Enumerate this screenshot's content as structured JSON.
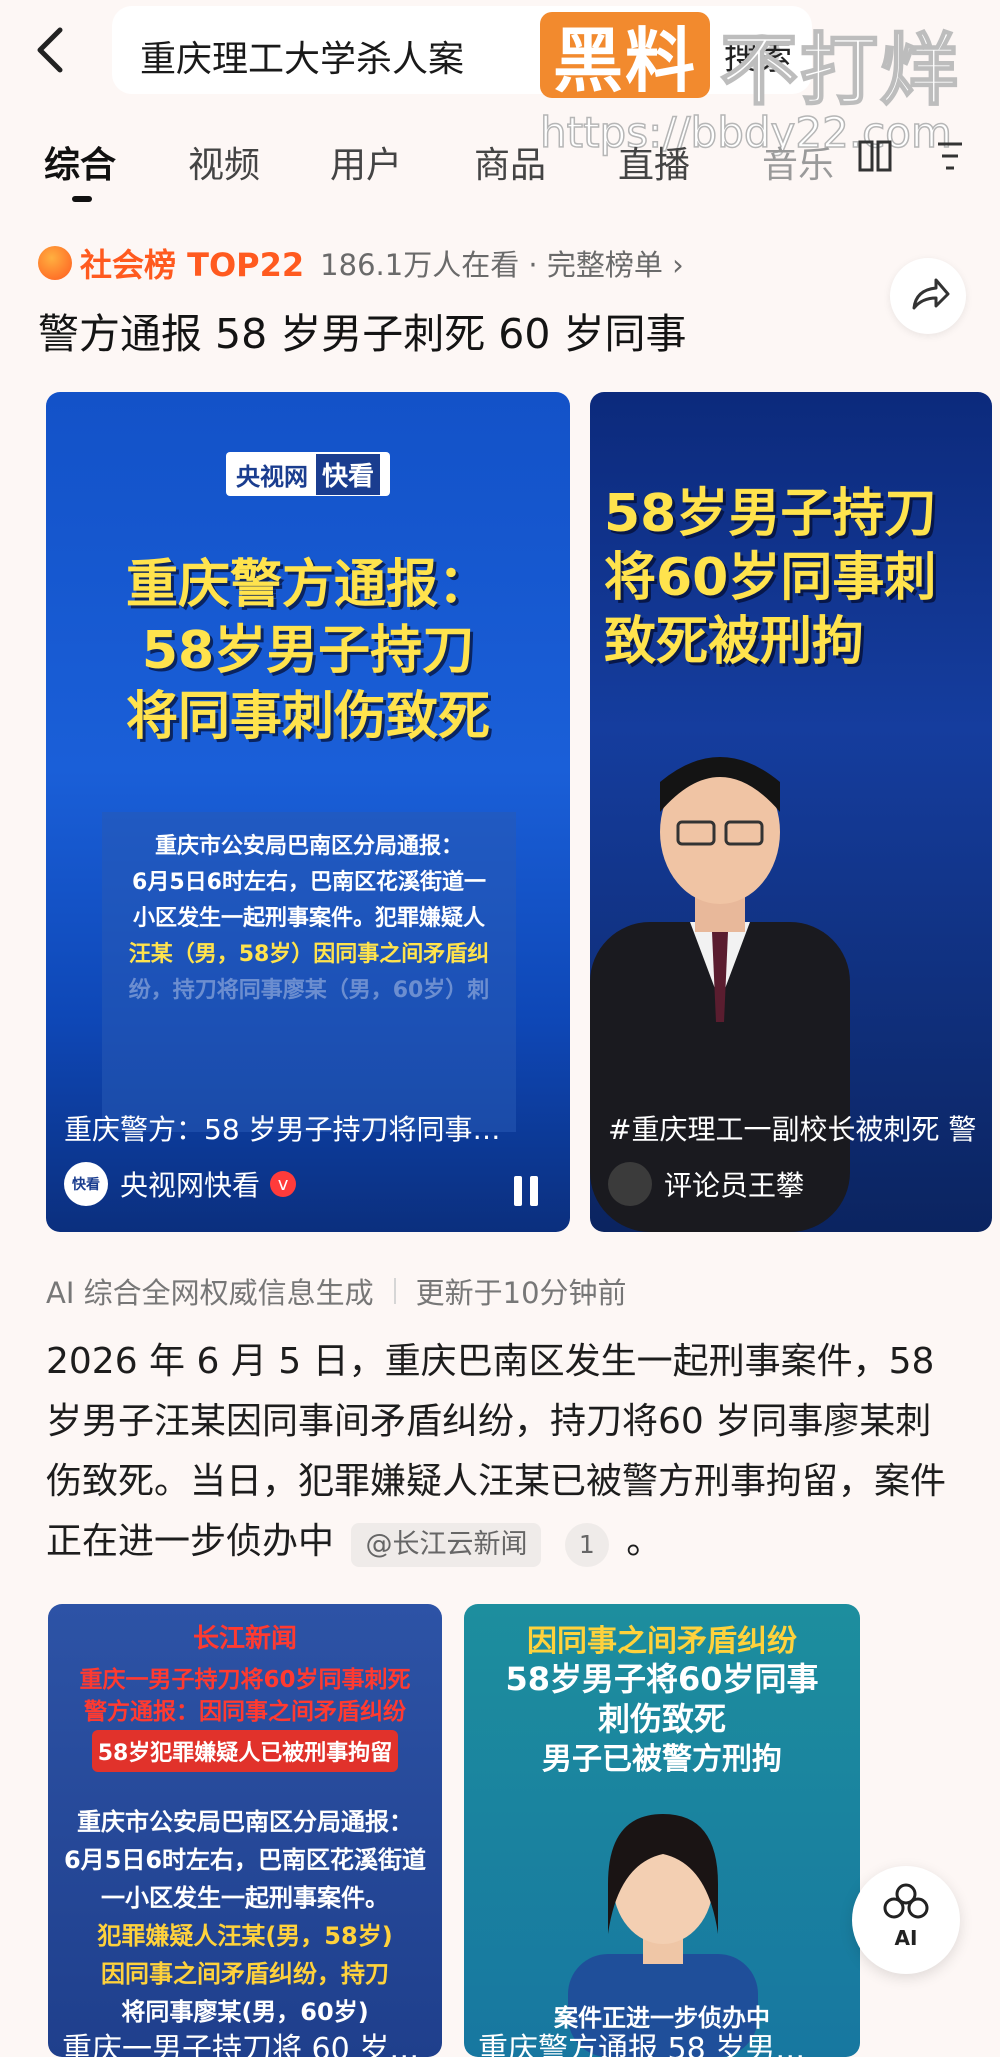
{
  "header": {
    "search_query": "重庆理工大学杀人案",
    "search_button": "搜索"
  },
  "watermark": {
    "logo": "黑料",
    "text": "不打烊",
    "url": "https://bbdy22.com"
  },
  "tabs": [
    "综合",
    "视频",
    "用户",
    "商品",
    "直播",
    "音乐"
  ],
  "hot": {
    "rank": "社会榜 TOP22",
    "meta": "186.1万人在看 · 完整榜单 ›",
    "headline": "警方通报 58 岁男子刺死 60 岁同事"
  },
  "card1": {
    "brand_a": "央视网",
    "brand_b": "快看",
    "title_lines": [
      "重庆警方通报：",
      "58岁男子持刀",
      "将同事刺伤致死"
    ],
    "notice_lines": [
      "重庆市公安局巴南区分局通报：",
      "6月5日6时左右，巴南区花溪街道一",
      "小区发生一起刑事案件。犯罪嫌疑人",
      "汪某（男，58岁）因同事之间矛盾纠",
      "纷，持刀将同事廖某（男，60岁）刺"
    ],
    "caption": "重庆警方：58 岁男子持刀将同事…",
    "author_avatar": "快看",
    "author": "央视网快看",
    "verified": "v"
  },
  "card2": {
    "title_lines": [
      "58岁男子持刀",
      "将60岁同事刺",
      "致死被刑拘"
    ],
    "caption": "#重庆理工一副校长被刺死 警",
    "author": "评论员王攀"
  },
  "ai": {
    "source_note": "AI 综合全网权威信息生成",
    "updated": "更新于10分钟前",
    "summary": "2026 年 6 月 5 日，重庆巴南区发生一起刑事案件，58 岁男子汪某因同事间矛盾纠纷，持刀将60 岁同事廖某刺伤致死。当日，犯罪嫌疑人汪某已被警方刑事拘留，案件正在进一步侦办中",
    "source_chip": "@长江云新闻",
    "source_count": "1",
    "period": "。"
  },
  "card3": {
    "logo": "长江新闻",
    "red_lines": [
      "重庆一男子持刀将60岁同事刺死",
      "警方通报：因同事之间矛盾纠纷"
    ],
    "badge": "58岁犯罪嫌疑人已被刑事拘留",
    "lines": [
      "重庆市公安局巴南区分局通报：",
      "6月5日6时左右，巴南区花溪街道",
      "一小区发生一起刑事案件。",
      "犯罪嫌疑人汪某(男，58岁)",
      "因同事之间矛盾纠纷，持刀",
      "将同事廖某(男，60岁)"
    ],
    "caption": "重庆一男子持刀将 60 岁…"
  },
  "card4": {
    "lines": [
      "因同事之间矛盾纠纷",
      "58岁男子将60岁同事",
      "刺伤致死",
      "男子已被警方刑拘"
    ],
    "subtitle": "案件正进一步侦办中",
    "caption": "重庆警方通报 58 岁男…"
  },
  "ai_float_label": "AI",
  "colors": {
    "accent": "#ff5a1f",
    "headline_yellow": "#ffe34d",
    "card_blue": "#1a5fd8"
  }
}
